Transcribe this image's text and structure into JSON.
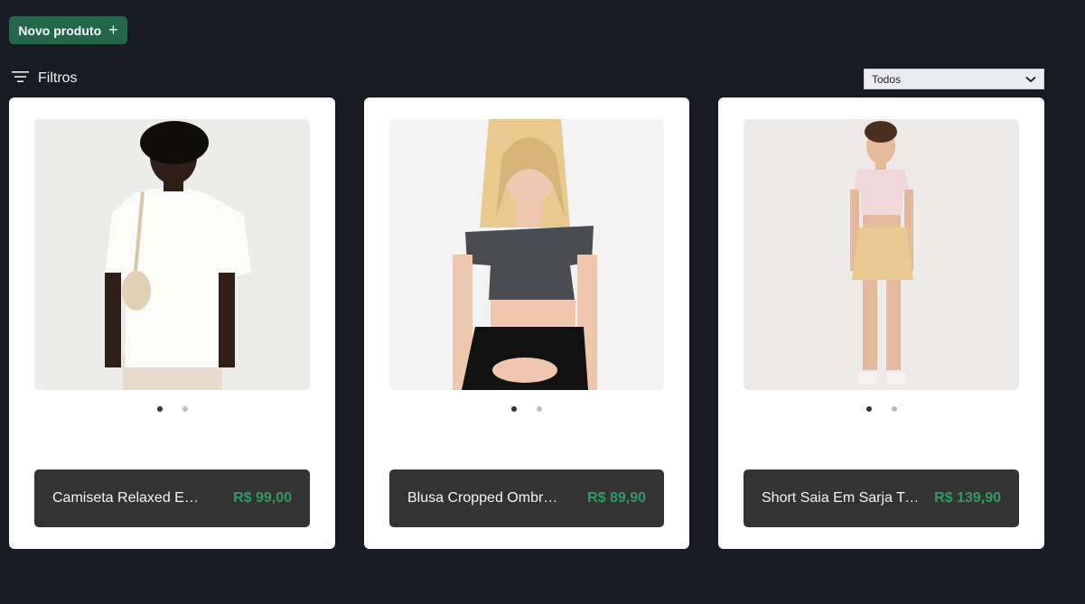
{
  "toolbar": {
    "new_product_label": "Novo produto",
    "new_product_icon": "plus-icon",
    "filters_label": "Filtros",
    "filters_icon": "filter-lines-icon"
  },
  "status_select": {
    "value": "Todos",
    "icon": "chevron-down-icon"
  },
  "colors": {
    "background": "#181b23",
    "primary_button": "#24664a",
    "card_bar": "#333333",
    "price": "#2f9a63"
  },
  "products": [
    {
      "name": "Camiseta Relaxed Em ...",
      "price": "R$ 99,00",
      "image_count": 2,
      "active_image": 1
    },
    {
      "name": "Blusa Cropped Ombro ...",
      "price": "R$ 89,90",
      "image_count": 2,
      "active_image": 1
    },
    {
      "name": "Short Saia Em Sarja Tra...",
      "price": "R$ 139,90",
      "image_count": 2,
      "active_image": 1
    }
  ]
}
